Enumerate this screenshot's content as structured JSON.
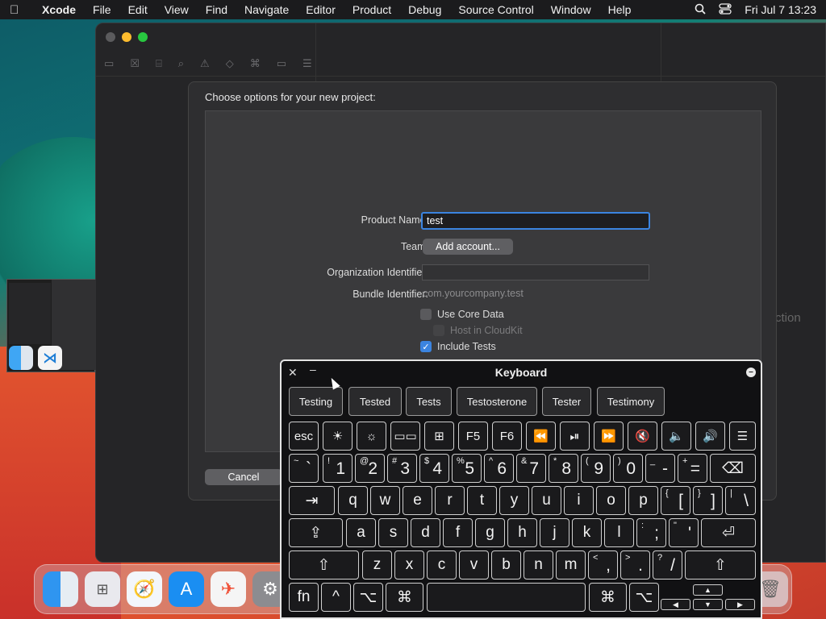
{
  "menubar": {
    "app_name": "Xcode",
    "items": [
      "File",
      "Edit",
      "View",
      "Find",
      "Navigate",
      "Editor",
      "Product",
      "Debug",
      "Source Control",
      "Window",
      "Help"
    ],
    "clock": "Fri Jul 7  13:23"
  },
  "xcode_window": {
    "background_text": "ction"
  },
  "sheet": {
    "title": "Choose options for your new project:",
    "product_name_label": "Product Name:",
    "product_name_value": "test",
    "team_label": "Team:",
    "add_account_label": "Add account...",
    "org_id_label": "Organization Identifier:",
    "org_id_value": "",
    "bundle_id_label": "Bundle Identifier:",
    "bundle_id_value": "com.yourcompany.test",
    "use_core_data_label": "Use Core Data",
    "use_core_data_checked": false,
    "host_cloudkit_label": "Host in CloudKit",
    "host_cloudkit_checked": false,
    "include_tests_label": "Include Tests",
    "include_tests_checked": true,
    "cancel_label": "Cancel"
  },
  "keyboard": {
    "title": "Keyboard",
    "suggestions": [
      "Testing",
      "Tested",
      "Tests",
      "Testosterone",
      "Tester",
      "Testimony"
    ],
    "function_row": [
      "esc",
      "☀",
      "☼",
      "▭▭",
      "⊞",
      "F5",
      "F6",
      "⏪",
      "⏯",
      "⏩",
      "🔇",
      "🔈",
      "🔊",
      "☰"
    ],
    "number_row": [
      {
        "shift": "~",
        "base": "`"
      },
      {
        "shift": "!",
        "base": "1"
      },
      {
        "shift": "@",
        "base": "2"
      },
      {
        "shift": "#",
        "base": "3"
      },
      {
        "shift": "$",
        "base": "4"
      },
      {
        "shift": "%",
        "base": "5"
      },
      {
        "shift": "^",
        "base": "6"
      },
      {
        "shift": "&",
        "base": "7"
      },
      {
        "shift": "*",
        "base": "8"
      },
      {
        "shift": "(",
        "base": "9"
      },
      {
        "shift": ")",
        "base": "0"
      },
      {
        "shift": "_",
        "base": "-"
      },
      {
        "shift": "+",
        "base": "="
      }
    ],
    "delete_label": "⌫",
    "tab_label": "⇥",
    "qwerty_row": [
      "q",
      "w",
      "e",
      "r",
      "t",
      "y",
      "u",
      "i",
      "o",
      "p"
    ],
    "qwerty_punct": [
      {
        "shift": "{",
        "base": "["
      },
      {
        "shift": "}",
        "base": "]"
      },
      {
        "shift": "|",
        "base": "\\"
      }
    ],
    "caps_label": "⇪",
    "home_row": [
      "a",
      "s",
      "d",
      "f",
      "g",
      "h",
      "j",
      "k",
      "l"
    ],
    "home_punct": [
      {
        "shift": ":",
        "base": ";"
      },
      {
        "shift": "\"",
        "base": "'"
      }
    ],
    "return_label": "⏎",
    "shift_label": "⇧",
    "bottom_letters": [
      "z",
      "x",
      "c",
      "v",
      "b",
      "n",
      "m"
    ],
    "bottom_punct": [
      {
        "shift": "<",
        "base": ","
      },
      {
        "shift": ">",
        "base": "."
      },
      {
        "shift": "?",
        "base": "/"
      }
    ],
    "fn_label": "fn",
    "ctrl_label": "^",
    "option_label": "⌥",
    "command_label": "⌘",
    "arrows": {
      "up": "▲",
      "left": "◀",
      "down": "▼",
      "right": "▶"
    }
  },
  "dock": {
    "apps": [
      "finder-icon",
      "launchpad-icon",
      "safari-icon",
      "app-store-icon",
      "swift-icon",
      "system-settings-icon",
      "trash-icon"
    ]
  }
}
